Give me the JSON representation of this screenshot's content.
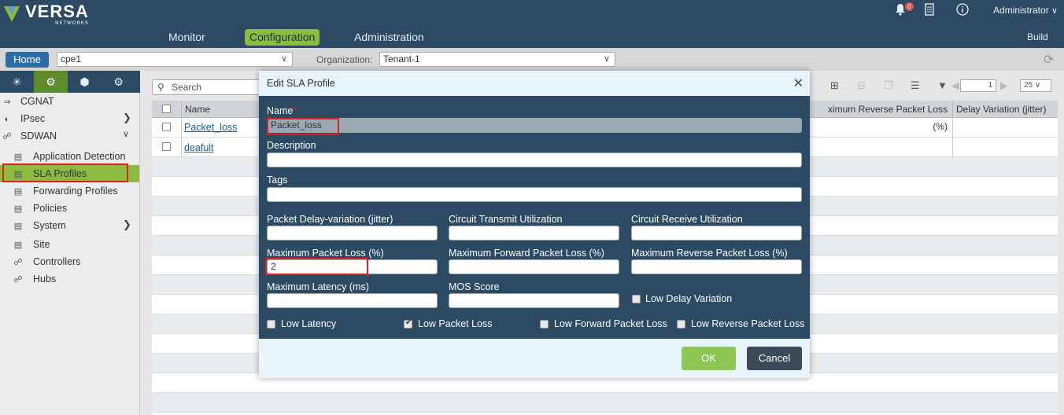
{
  "brand": {
    "name": "VERSA",
    "sub": "NETWORKS"
  },
  "nav": {
    "tabs": [
      {
        "label": "Monitor"
      },
      {
        "label": "Configuration"
      },
      {
        "label": "Administration"
      }
    ],
    "active_tab": "Configuration",
    "user": "Administrator",
    "notifications": "0",
    "build_label": "Build"
  },
  "context": {
    "home_label": "Home",
    "device": "cpe1",
    "org_label": "Organization:",
    "org_value": "Tenant-1"
  },
  "sidebar": {
    "items": [
      {
        "label": "CGNAT",
        "icon": "cgnat-icon"
      },
      {
        "label": "IPsec",
        "icon": "globe-icon",
        "expandable": true
      },
      {
        "label": "SDWAN",
        "icon": "sdwan-icon",
        "expanded": true
      },
      {
        "label": "Application Detection",
        "icon": "doc-icon"
      },
      {
        "label": "SLA Profiles",
        "icon": "sla-icon",
        "selected": true
      },
      {
        "label": "Forwarding Profiles",
        "icon": "forward-icon"
      },
      {
        "label": "Policies",
        "icon": "policy-icon"
      },
      {
        "label": "System",
        "icon": "system-icon",
        "expandable": true
      },
      {
        "label": "Site",
        "icon": "site-icon"
      },
      {
        "label": "Controllers",
        "icon": "controllers-icon"
      },
      {
        "label": "Hubs",
        "icon": "hubs-icon"
      }
    ]
  },
  "main": {
    "search_placeholder": "Search",
    "columns": [
      "Name",
      "ximum Reverse Packet Loss (%)",
      "Delay Variation (jitter)"
    ],
    "rows": [
      {
        "name": "Packet_loss"
      },
      {
        "name": "deafult"
      }
    ],
    "page_value": "1",
    "page_size": "25"
  },
  "modal": {
    "title": "Edit SLA Profile",
    "name_label": "Name",
    "name_required": "*",
    "name_value": "Packet_loss",
    "description_label": "Description",
    "description_value": "",
    "tags_label": "Tags",
    "tags_value": "",
    "fields": {
      "jitter_label": "Packet Delay-variation (jitter)",
      "circuit_tx_label": "Circuit Transmit Utilization",
      "circuit_rx_label": "Circuit Receive Utilization",
      "max_loss_label": "Maximum Packet Loss (%)",
      "max_loss_value": "2",
      "max_fwd_loss_label": "Maximum Forward Packet Loss (%)",
      "max_rev_loss_label": "Maximum Reverse Packet Loss (%)",
      "max_latency_label": "Maximum Latency (ms)",
      "mos_label": "MOS Score",
      "low_delay_var_label": "Low Delay Variation"
    },
    "checks": {
      "low_latency": {
        "label": "Low Latency",
        "checked": false
      },
      "low_packet_loss": {
        "label": "Low Packet Loss",
        "checked": true
      },
      "low_fwd_loss": {
        "label": "Low Forward Packet Loss",
        "checked": false
      },
      "low_rev_loss": {
        "label": "Low Reverse Packet Loss",
        "checked": false
      },
      "low_delay_var": {
        "checked": false
      }
    },
    "ok_label": "OK",
    "cancel_label": "Cancel"
  },
  "colors": {
    "header": "#2c4a63",
    "accent_green": "#8cbc3f",
    "highlight_red": "#e02020",
    "home_blue": "#2e6da4"
  }
}
